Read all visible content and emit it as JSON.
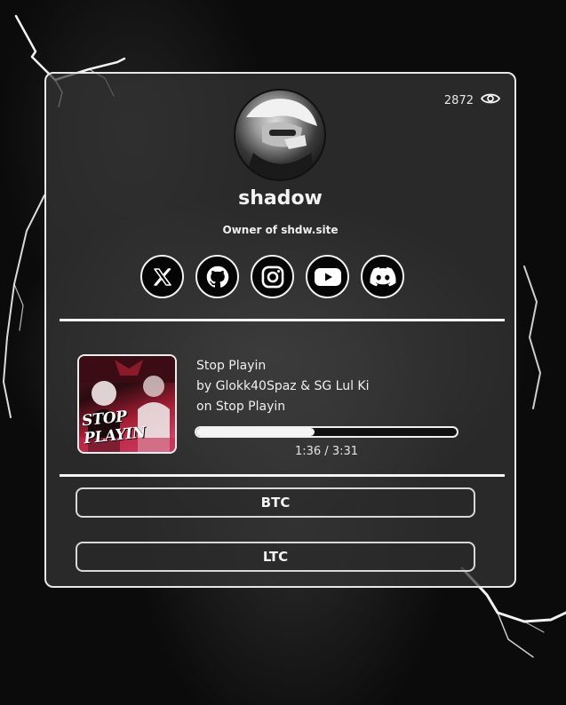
{
  "profile": {
    "view_count": "2872",
    "username": "shadow",
    "bio": "Owner of shdw.site"
  },
  "socials": [
    {
      "icon": "x-icon"
    },
    {
      "icon": "github-icon"
    },
    {
      "icon": "instagram-icon"
    },
    {
      "icon": "youtube-icon"
    },
    {
      "icon": "discord-icon"
    }
  ],
  "player": {
    "title": "Stop Playin",
    "artist_line": "by Glokk40Spaz & SG Lul Ki",
    "album_line": "on Stop Playin",
    "elapsed": "1:36",
    "duration": "3:31",
    "time_display": "1:36 / 3:31",
    "progress_fraction": 0.455,
    "cover_text": "STOP PLAYIN"
  },
  "crypto": {
    "btc_label": "BTC",
    "ltc_label": "LTC"
  },
  "colors": {
    "card_border": "#e8e8e8",
    "accent": "#f4f4f4",
    "background": "#0b0b0b"
  }
}
